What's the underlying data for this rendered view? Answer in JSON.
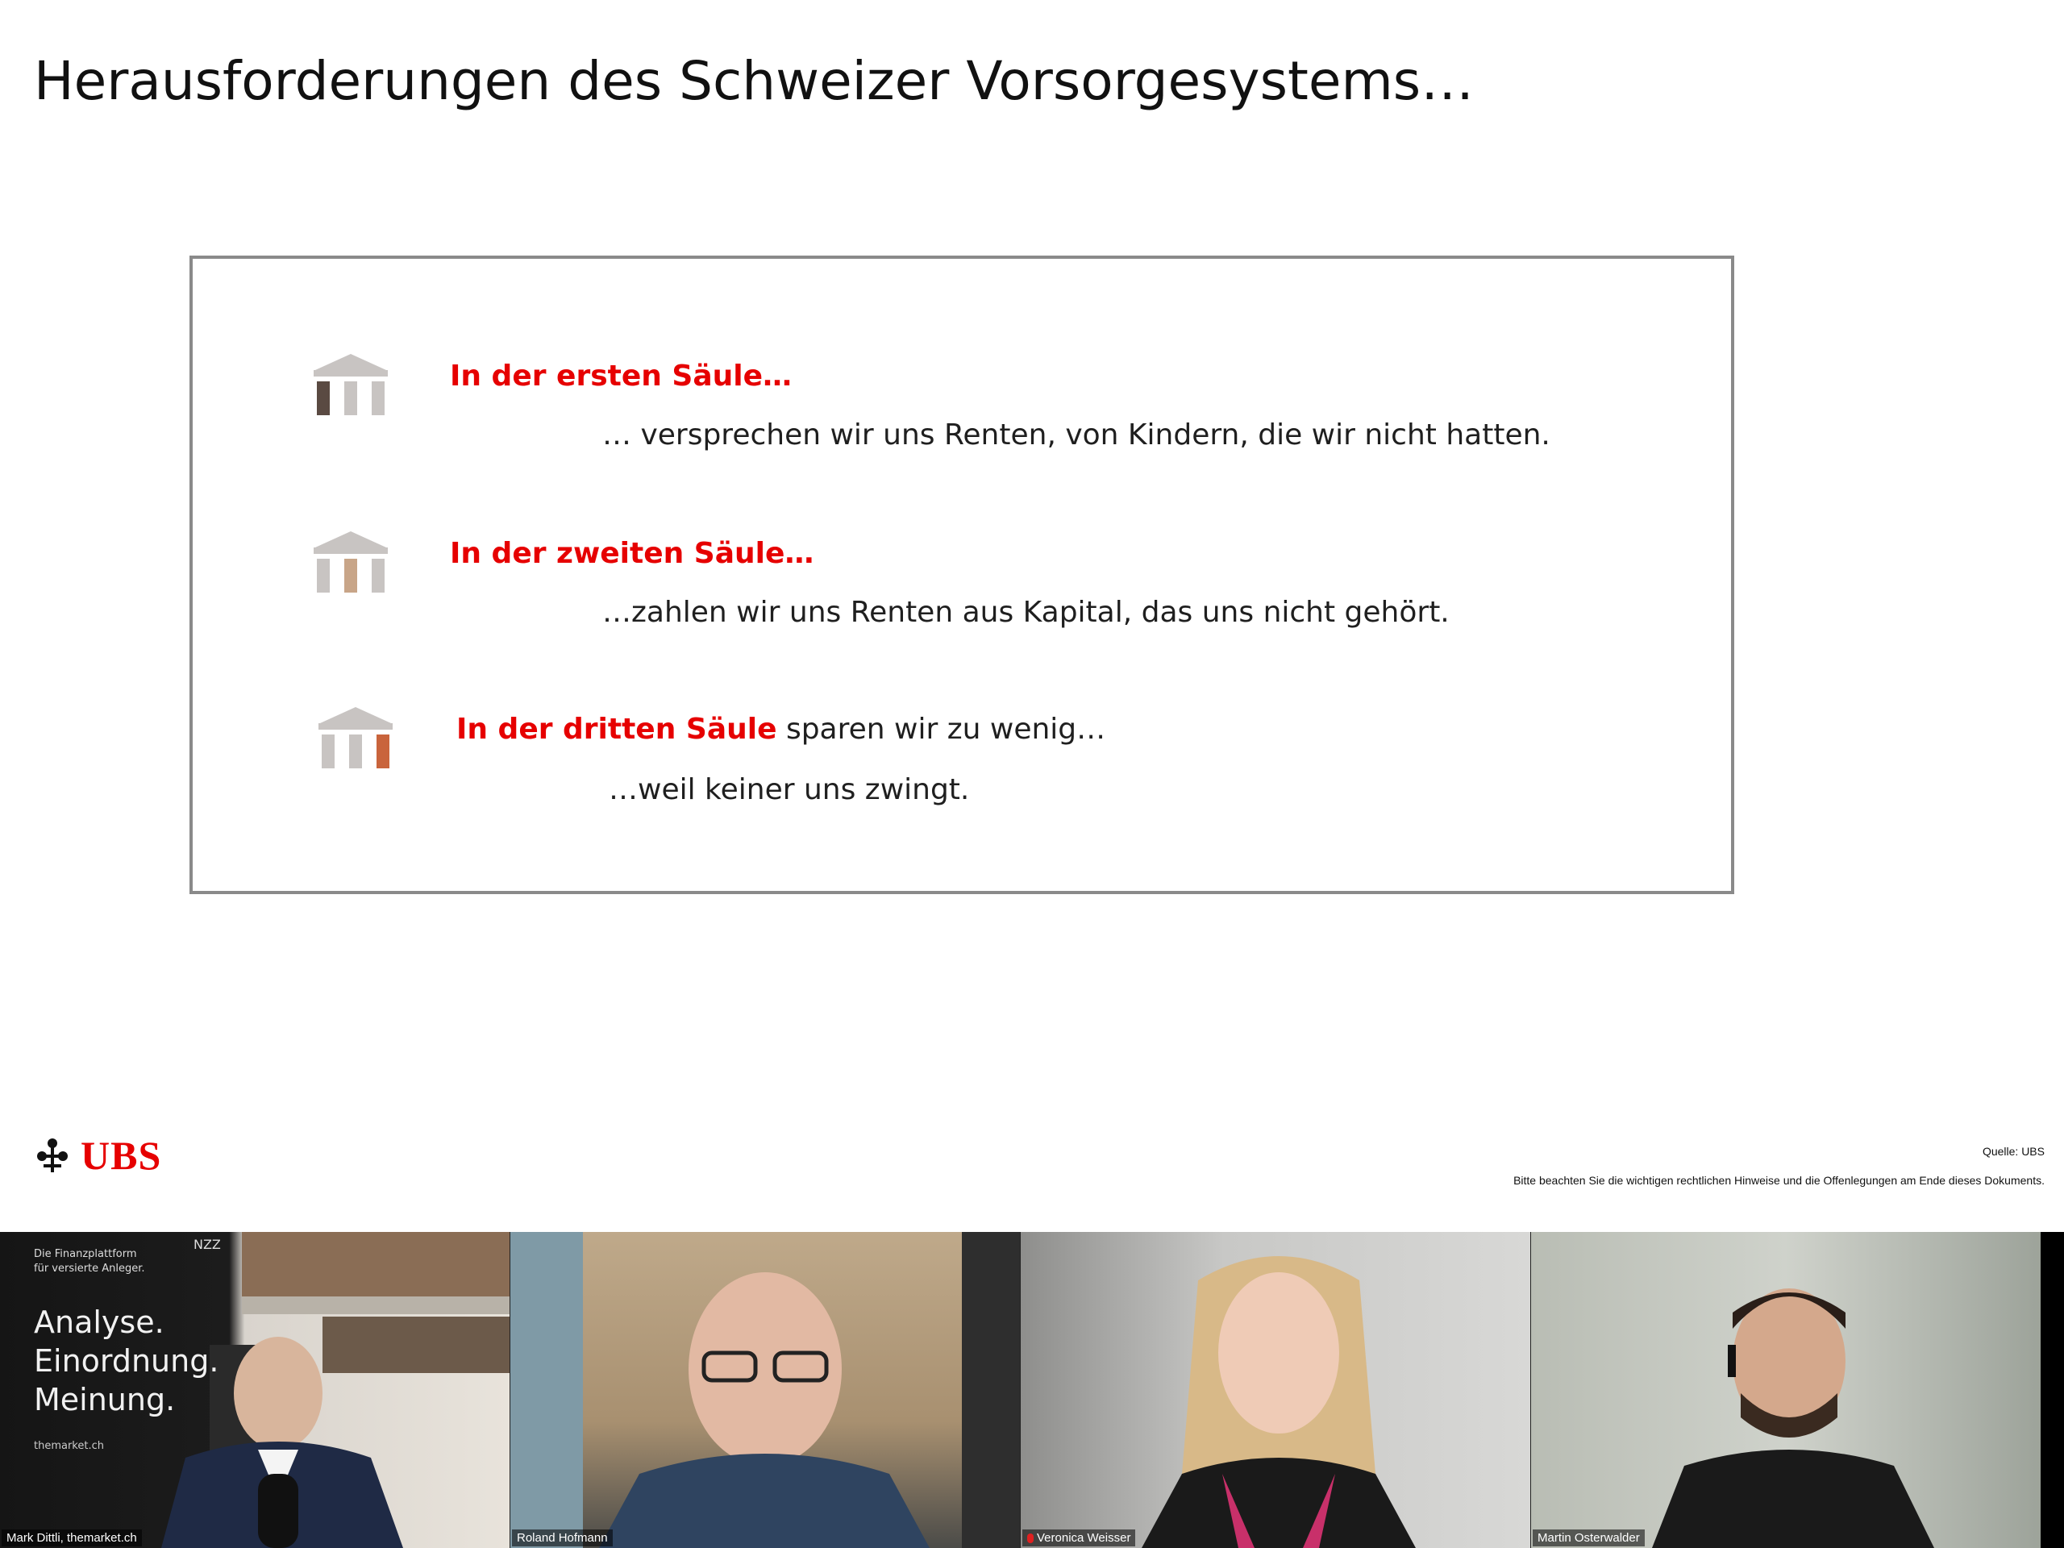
{
  "slide": {
    "title": "Herausforderungen des Schweizer Vorsorgesystems…",
    "pillars": [
      {
        "heading_red": "In der ersten Säule…",
        "heading_rest": "",
        "text": "… versprechen wir uns Renten, von Kindern, die wir nicht hatten.",
        "icon": "pillar-first-icon"
      },
      {
        "heading_red": "In der zweiten Säule…",
        "heading_rest": "",
        "text": "…zahlen wir uns Renten aus Kapital, das uns nicht gehört.",
        "icon": "pillar-second-icon"
      },
      {
        "heading_red": "In der dritten Säule",
        "heading_rest": " sparen wir zu wenig…",
        "text": "…weil keiner uns zwingt.",
        "icon": "pillar-third-icon"
      }
    ],
    "logo": "UBS",
    "source": "Quelle: UBS",
    "disclaimer": "Bitte beachten Sie die wichtigen rechtlichen Hinweise und die Offenlegungen am Ende dieses Dokuments."
  },
  "participants": [
    {
      "name": "Mark Dittli, themarket.ch",
      "poster_line1": "Die Finanzplattform",
      "poster_line2": "für versierte Anleger.",
      "poster_big1": "Analyse.",
      "poster_big2": "Einordnung.",
      "poster_big3": "Meinung.",
      "poster_site": "themarket.ch",
      "poster_brand": "NZZ"
    },
    {
      "name": "Roland Hofmann"
    },
    {
      "name": "Veronica Weisser",
      "muted": true
    },
    {
      "name": "Martin Osterwalder"
    }
  ],
  "colors": {
    "accent": "#e60000",
    "pillar_gray": "#c8c4c2",
    "pillar1": "#5a4a42",
    "pillar2": "#c8a588",
    "pillar3": "#c9643c"
  }
}
